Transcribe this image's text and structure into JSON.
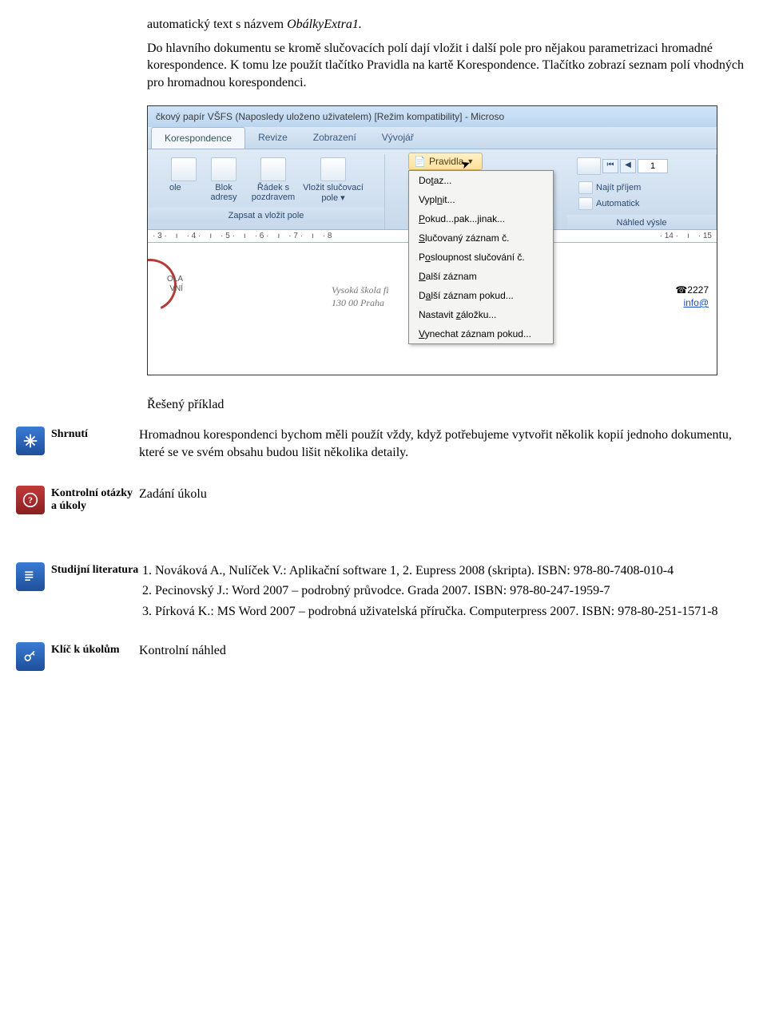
{
  "intro": {
    "p1_pre": "automatický text s názvem ",
    "p1_italic": "ObálkyExtra1.",
    "p2": "Do hlavního dokumentu se kromě slučovacích polí dají vložit i další pole pro nějakou parametrizaci hromadné korespondence. K tomu lze použít tlačítko Pravidla na kartě Korespondence. Tlačítko zobrazí seznam polí vhodných pro hromadnou korespondenci."
  },
  "screenshot": {
    "title": "čkový papír VŠFS (Naposledy uloženo uživatelem) [Režim kompatibility] - Microso",
    "tabs": [
      "Korespondence",
      "Revize",
      "Zobrazení",
      "Vývojář"
    ],
    "active_tab": 0,
    "group1": {
      "btn1_top": "ole",
      "btn1": "Blok adresy",
      "btn2": "Řádek s pozdravem",
      "btn3": "Vložit slučovací pole ▾",
      "label": "Zapsat a vložit pole"
    },
    "pravidla_btn": "Pravidla",
    "dropdown": [
      "Dotaz...",
      "Vyplnit...",
      "Pokud...pak...jinak...",
      "Slučovaný záznam č.",
      "Posloupnost slučování č.",
      "Další záznam",
      "Další záznam pokud...",
      "Nastavit záložku...",
      "Vynechat záznam pokud..."
    ],
    "dropdown_u": [
      "t",
      "I",
      "P",
      "S",
      "o",
      "D",
      "a",
      "z",
      "V"
    ],
    "right_group": {
      "row1": "Najít příjem",
      "row2": "Automatick",
      "label": "Náhled výsle"
    },
    "nav_value": "1",
    "ruler_left": [
      "· 3 ·",
      "ı",
      "· 4 ·",
      "ı",
      "· 5 ·",
      "ı",
      "· 6 ·",
      "ı",
      "· 7 ·",
      "ı",
      "· 8"
    ],
    "ruler_right": [
      "· 14 ·",
      "ı",
      "· 15"
    ],
    "letterhead_l1": "Vysoká škola fi",
    "letterhead_l2": "130 00 Praha",
    "contact_tel": "☎2227",
    "contact_link": "info@",
    "logo_text1": "OLA",
    "logo_text2": "VNÍ"
  },
  "solved_heading": "Řešený příklad",
  "shrnuti": {
    "label": "Shrnutí",
    "body": "Hromadnou korespondenci bychom měli použít vždy, když potřebujeme vytvořit několik kopií jednoho dokumentu, které se ve svém obsahu budou lišit několika detaily."
  },
  "kontrolni": {
    "label": "Kontrolní otázky a úkoly",
    "body": "Zadání úkolu"
  },
  "literatura": {
    "label": "Studijní literatura",
    "items": [
      "Nováková A., Nulíček V.: Aplikační software 1, 2. Eupress 2008 (skripta). ISBN: 978-80-7408-010-4",
      "Pecinovský J.: Word 2007 – podrobný průvodce. Grada 2007. ISBN: 978-80-247-1959-7",
      "Pírková K.: MS Word 2007 – podrobná uživatelská příručka. Computerpress 2007. ISBN: 978-80-251-1571-8"
    ]
  },
  "klic": {
    "label": "Klíč k úkolům",
    "body": "Kontrolní náhled"
  }
}
